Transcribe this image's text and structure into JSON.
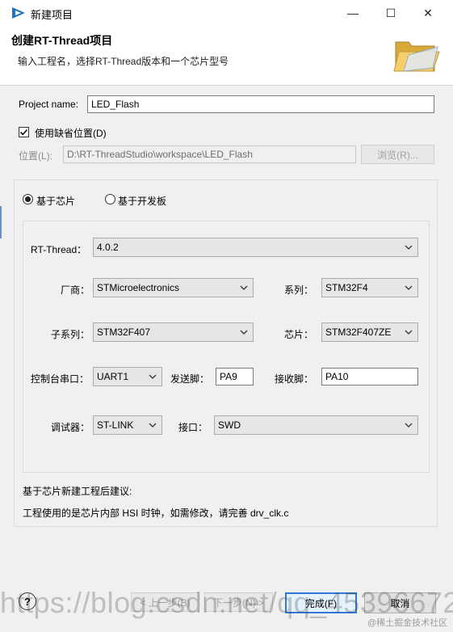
{
  "window": {
    "title": "新建项目",
    "minimize_glyph": "—",
    "maximize_glyph": "☐",
    "close_glyph": "✕"
  },
  "banner": {
    "title": "创建RT-Thread项目",
    "description": "输入工程名，选择RT-Thread版本和一个芯片型号"
  },
  "project": {
    "name_label": "Project name:",
    "name_value": "LED_Flash",
    "use_default_label": "使用缺省位置(D)",
    "use_default_checked": true,
    "location_label": "位置(L):",
    "location_value": "D:\\RT-ThreadStudio\\workspace\\LED_Flash",
    "browse_label": "浏览(R)..."
  },
  "mode": {
    "chip_label": "基于芯片",
    "board_label": "基于开发板",
    "selected": "chip"
  },
  "config": {
    "rtthread_label": "RT-Thread：",
    "rtthread_value": "4.0.2",
    "vendor_label": "厂商：",
    "vendor_value": "STMicroelectronics",
    "series_label": "系列：",
    "series_value": "STM32F4",
    "subseries_label": "子系列：",
    "subseries_value": "STM32F407",
    "chip_label": "芯片：",
    "chip_value": "STM32F407ZE",
    "console_label": "控制台串口：",
    "console_value": "UART1",
    "tx_label": "发送脚：",
    "tx_value": "PA9",
    "rx_label": "接收脚：",
    "rx_value": "PA10",
    "debugger_label": "调试器：",
    "debugger_value": "ST-LINK",
    "interface_label": "接口：",
    "interface_value": "SWD"
  },
  "advice": {
    "title": "基于芯片新建工程后建议:",
    "text": "工程使用的是芯片内部 HSI 时钟，如需修改，请完善 drv_clk.c"
  },
  "footer": {
    "help_glyph": "?",
    "back_label": "< 上一步(B)",
    "next_label": "下一步(N) >",
    "finish_label": "完成(F)",
    "cancel_label": "取消",
    "watermark": "https://blog.csdn.net/qq_45396672",
    "watermark_small": "@稀土掘金技术社区"
  },
  "colors": {
    "accent": "#2f7ad6",
    "app_icon": "#1e73be"
  }
}
